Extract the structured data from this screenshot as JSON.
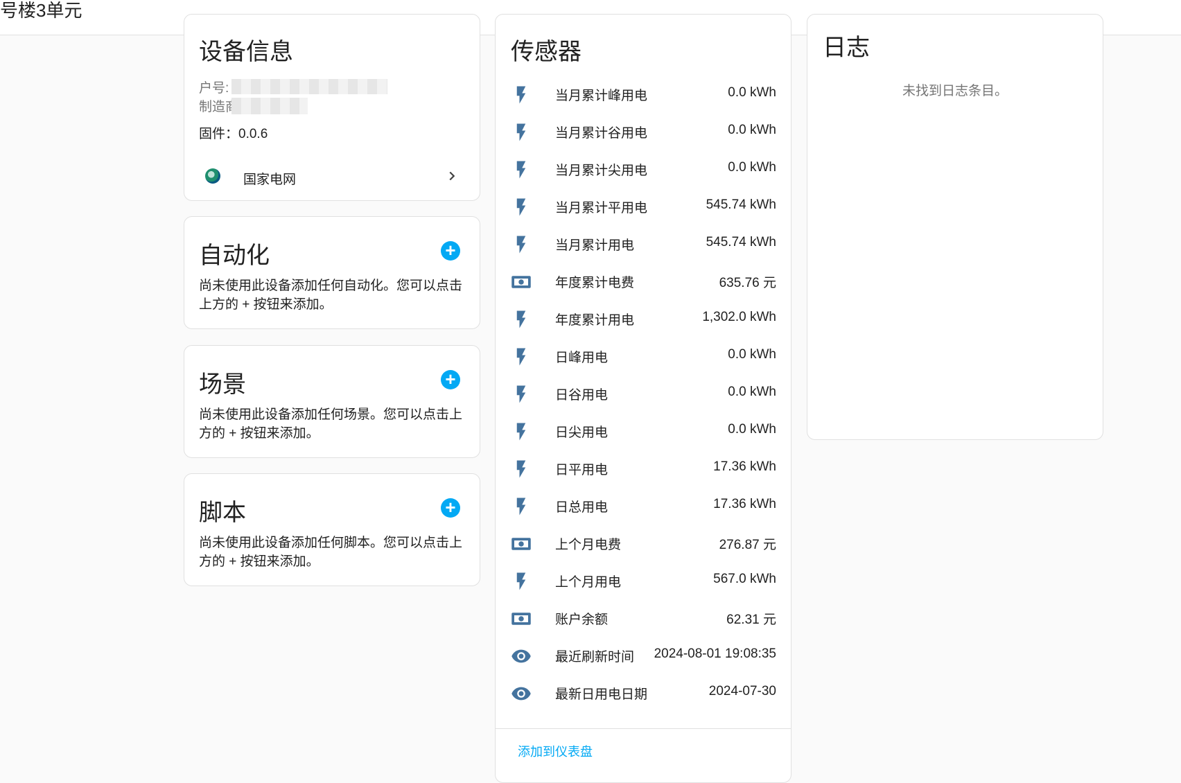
{
  "header": {
    "title": "号楼3单元"
  },
  "device_info": {
    "title": "设备信息",
    "account_label": "户号:",
    "manufacturer_label": "制造商",
    "firmware": "固件：0.0.6",
    "integration_label": "国家电网"
  },
  "automation": {
    "title": "自动化",
    "description": "尚未使用此设备添加任何自动化。您可以点击上方的 + 按钮来添加。"
  },
  "scene": {
    "title": "场景",
    "description": "尚未使用此设备添加任何场景。您可以点击上方的 + 按钮来添加。"
  },
  "script": {
    "title": "脚本",
    "description": "尚未使用此设备添加任何脚本。您可以点击上方的 + 按钮来添加。"
  },
  "sensors": {
    "title": "传感器",
    "add_to_dashboard": "添加到仪表盘",
    "icon_color": "#44739e",
    "items": [
      {
        "icon": "flash-icon",
        "name": "当月累计峰用电",
        "value": "0.0 kWh"
      },
      {
        "icon": "flash-icon",
        "name": "当月累计谷用电",
        "value": "0.0 kWh"
      },
      {
        "icon": "flash-icon",
        "name": "当月累计尖用电",
        "value": "0.0 kWh"
      },
      {
        "icon": "flash-icon",
        "name": "当月累计平用电",
        "value": "545.74 kWh"
      },
      {
        "icon": "flash-icon",
        "name": "当月累计用电",
        "value": "545.74 kWh"
      },
      {
        "icon": "cash-icon",
        "name": "年度累计电费",
        "value": "635.76 元"
      },
      {
        "icon": "flash-icon",
        "name": "年度累计用电",
        "value": "1,302.0 kWh"
      },
      {
        "icon": "flash-icon",
        "name": "日峰用电",
        "value": "0.0 kWh"
      },
      {
        "icon": "flash-icon",
        "name": "日谷用电",
        "value": "0.0 kWh"
      },
      {
        "icon": "flash-icon",
        "name": "日尖用电",
        "value": "0.0 kWh"
      },
      {
        "icon": "flash-icon",
        "name": "日平用电",
        "value": "17.36 kWh"
      },
      {
        "icon": "flash-icon",
        "name": "日总用电",
        "value": "17.36 kWh"
      },
      {
        "icon": "cash-icon",
        "name": "上个月电费",
        "value": "276.87 元"
      },
      {
        "icon": "flash-icon",
        "name": "上个月用电",
        "value": "567.0 kWh"
      },
      {
        "icon": "cash-icon",
        "name": "账户余额",
        "value": "62.31 元"
      },
      {
        "icon": "eye-icon",
        "name": "最近刷新时间",
        "value": "2024-08-01 19:08:35"
      },
      {
        "icon": "eye-icon",
        "name": "最新日用电日期",
        "value": "2024-07-30"
      }
    ]
  },
  "logbook": {
    "title": "日志",
    "empty_text": "未找到日志条目。"
  },
  "colors": {
    "accent": "#03a9f4",
    "icon": "#44739e"
  }
}
